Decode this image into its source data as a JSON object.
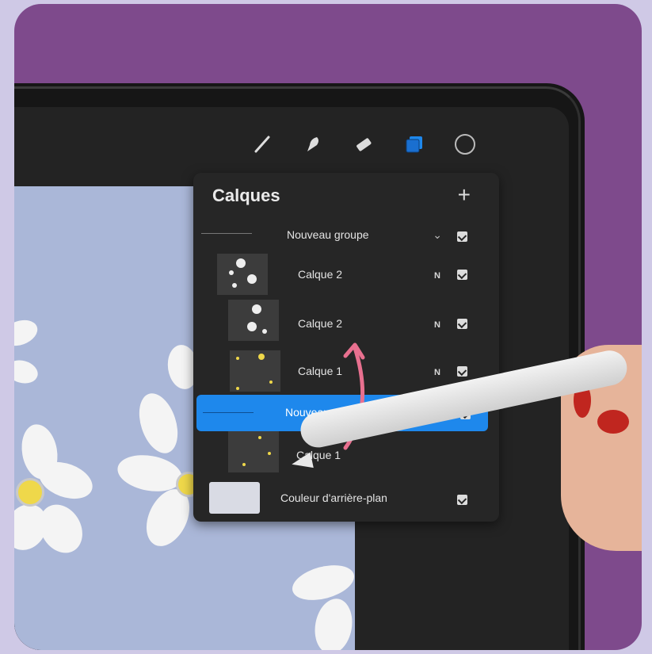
{
  "panel": {
    "title": "Calques",
    "add_label": "+",
    "layers": [
      {
        "type": "group",
        "label": "Nouveau groupe",
        "expanded": true,
        "visible": true,
        "selected": false
      },
      {
        "type": "layer",
        "label": "Calque 2",
        "blend": "N",
        "visible": true,
        "selected": false
      },
      {
        "type": "layer",
        "label": "Calque 2",
        "blend": "N",
        "visible": true,
        "selected": false
      },
      {
        "type": "layer",
        "label": "Calque 1",
        "blend": "N",
        "visible": true,
        "selected": false
      },
      {
        "type": "group",
        "label": "Nouveau groupe",
        "expanded": false,
        "visible": true,
        "selected": true
      },
      {
        "type": "layer",
        "label": "Calque 1",
        "blend": "N",
        "visible": true,
        "selected": false
      }
    ],
    "background": {
      "label": "Couleur d'arrière-plan",
      "visible": true
    }
  },
  "toolbar": {
    "tools": [
      "brush-icon",
      "smudge-icon",
      "eraser-icon",
      "layers-icon",
      "color-icon"
    ],
    "active": "layers-icon"
  },
  "colors": {
    "accent": "#1e88ec",
    "panel_bg": "#262626",
    "canvas_bg": "#aab7d8",
    "frame_bg": "#7e4a8c",
    "annotation_arrow": "#e8708f"
  }
}
